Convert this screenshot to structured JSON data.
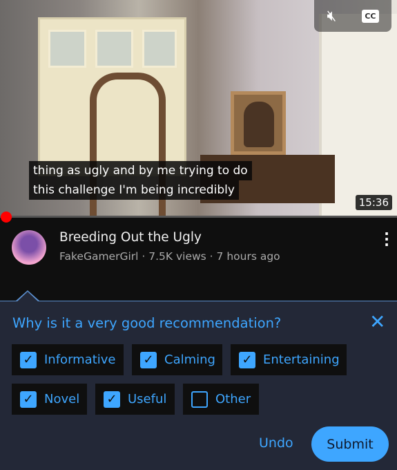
{
  "video": {
    "subtitle_lines": [
      "thing as ugly and by me trying to do",
      "this challenge I'm being incredibly"
    ],
    "duration": "15:36",
    "cc_label": "CC",
    "progress_fraction": 0.0
  },
  "info": {
    "title": "Breeding Out the Ugly",
    "meta": "FakeGamerGirl · 7.5K views · 7 hours ago"
  },
  "feedback": {
    "question": "Why is it a very good recommendation?",
    "options": [
      {
        "label": "Informative",
        "checked": true
      },
      {
        "label": "Calming",
        "checked": true
      },
      {
        "label": "Entertaining",
        "checked": true
      },
      {
        "label": "Novel",
        "checked": true
      },
      {
        "label": "Useful",
        "checked": true
      },
      {
        "label": "Other",
        "checked": false
      }
    ],
    "undo_label": "Undo",
    "submit_label": "Submit"
  },
  "colors": {
    "accent": "#3ea6ff",
    "panel": "#232837",
    "progress": "#ff0000"
  }
}
